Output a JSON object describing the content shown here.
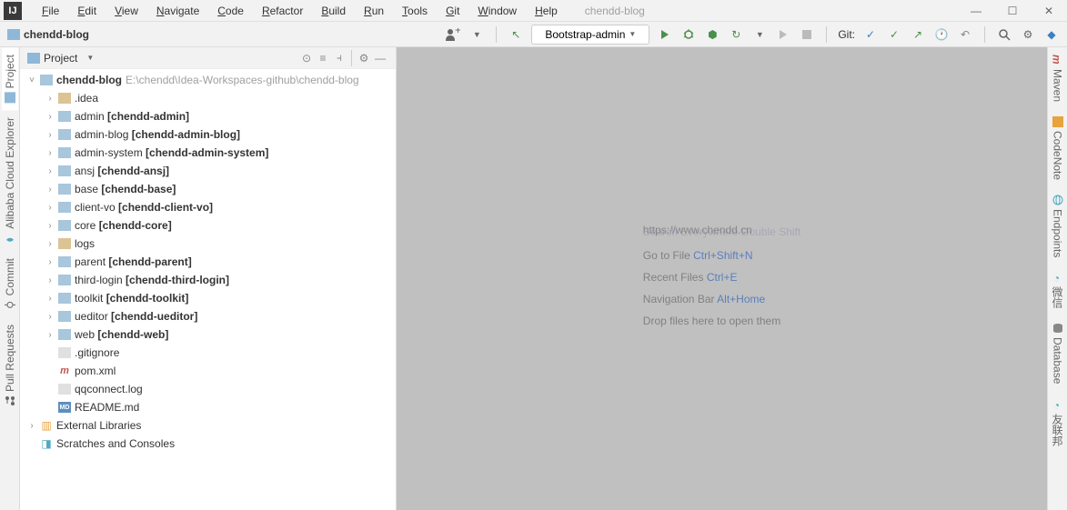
{
  "menubar": {
    "items": [
      "File",
      "Edit",
      "View",
      "Navigate",
      "Code",
      "Refactor",
      "Build",
      "Run",
      "Tools",
      "Git",
      "Window",
      "Help"
    ],
    "project_title": "chendd-blog"
  },
  "window_controls": {
    "min": "—",
    "max": "☐",
    "close": "✕"
  },
  "breadcrumb": {
    "project": "chendd-blog"
  },
  "toolbar": {
    "run_config": "Bootstrap-admin",
    "git_label": "Git:"
  },
  "left_gutter": [
    "Project",
    "Alibaba Cloud Explorer",
    "Commit",
    "Pull Requests"
  ],
  "project_panel": {
    "title": "Project"
  },
  "tree": {
    "root_name": "chendd-blog",
    "root_path": "E:\\chendd\\Idea-Workspaces-github\\chendd-blog",
    "children": [
      {
        "name": ".idea",
        "type": "fld-ex",
        "expandable": true
      },
      {
        "name": "admin",
        "bold": "[chendd-admin]",
        "type": "fld",
        "expandable": true
      },
      {
        "name": "admin-blog",
        "bold": "[chendd-admin-blog]",
        "type": "fld",
        "expandable": true
      },
      {
        "name": "admin-system",
        "bold": "[chendd-admin-system]",
        "type": "fld",
        "expandable": true
      },
      {
        "name": "ansj",
        "bold": "[chendd-ansj]",
        "type": "fld",
        "expandable": true
      },
      {
        "name": "base",
        "bold": "[chendd-base]",
        "type": "fld",
        "expandable": true
      },
      {
        "name": "client-vo",
        "bold": "[chendd-client-vo]",
        "type": "fld",
        "expandable": true
      },
      {
        "name": "core",
        "bold": "[chendd-core]",
        "type": "fld",
        "expandable": true
      },
      {
        "name": "logs",
        "type": "fld-ex",
        "expandable": true
      },
      {
        "name": "parent",
        "bold": "[chendd-parent]",
        "type": "fld",
        "expandable": true
      },
      {
        "name": "third-login",
        "bold": "[chendd-third-login]",
        "type": "fld",
        "expandable": true
      },
      {
        "name": "toolkit",
        "bold": "[chendd-toolkit]",
        "type": "fld",
        "expandable": true
      },
      {
        "name": "ueditor",
        "bold": "[chendd-ueditor]",
        "type": "fld",
        "expandable": true
      },
      {
        "name": "web",
        "bold": "[chendd-web]",
        "type": "fld",
        "expandable": true
      },
      {
        "name": ".gitignore",
        "type": "txt",
        "expandable": false
      },
      {
        "name": "pom.xml",
        "type": "m",
        "expandable": false
      },
      {
        "name": "qqconnect.log",
        "type": "txt",
        "expandable": false
      },
      {
        "name": "README.md",
        "type": "md",
        "expandable": false
      }
    ],
    "ext_lib": "External Libraries",
    "scratches": "Scratches and Consoles"
  },
  "empty_editor": {
    "watermark_under": "Search Everywhere Double Shift",
    "watermark_over": "https://www.chendd.cn",
    "hints": [
      {
        "label": "Go to File ",
        "shortcut": "Ctrl+Shift+N"
      },
      {
        "label": "Recent Files ",
        "shortcut": "Ctrl+E"
      },
      {
        "label": "Navigation Bar ",
        "shortcut": "Alt+Home"
      },
      {
        "label": "Drop files here to open them",
        "shortcut": ""
      }
    ]
  },
  "right_gutter": [
    "Maven",
    "CodeNote",
    "Endpoints",
    "微信",
    "Database",
    "友联邦"
  ]
}
